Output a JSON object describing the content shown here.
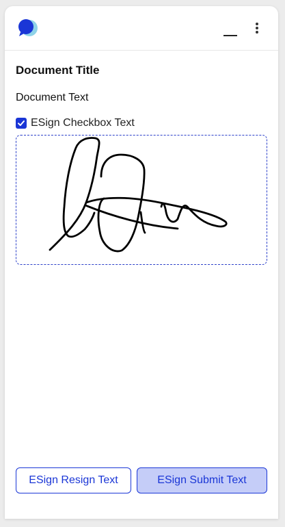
{
  "header": {
    "logo_icon": "chat-bubble-logo-icon",
    "minimize_icon": "minimize-icon",
    "more_icon": "more-vertical-icon"
  },
  "document": {
    "title": "Document Title",
    "text": "Document Text"
  },
  "esign": {
    "checkbox_label": "ESign Checkbox Text",
    "checkbox_checked": true,
    "signature_present": true,
    "resign_label": "ESign Resign Text",
    "submit_label": "ESign Submit Text"
  },
  "colors": {
    "accent": "#1a36d6",
    "submit_background": "#c5cdf8",
    "logo_primary": "#1a36d6",
    "logo_secondary": "#8fd3e8"
  }
}
